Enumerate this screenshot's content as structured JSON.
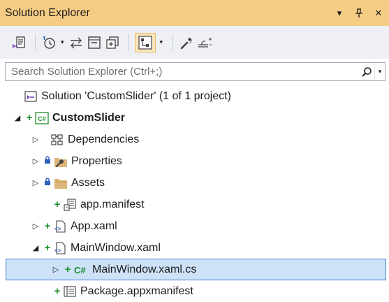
{
  "panel": {
    "title": "Solution Explorer",
    "controls": [
      {
        "name": "dropdown",
        "glyph": "▾"
      },
      {
        "name": "pin",
        "glyph": "⊥"
      },
      {
        "name": "close",
        "glyph": "✕"
      }
    ]
  },
  "toolbar": {
    "icons": [
      "switch-views-icon",
      "pending-changes-filter-icon",
      "sync-with-active-document-icon",
      "collapse-all-icon",
      "show-all-files-icon",
      "preview-selected-items-icon",
      "properties-icon",
      "preview-pane-icon"
    ]
  },
  "search": {
    "placeholder": "Search Solution Explorer (Ctrl+;)"
  },
  "tree": {
    "solution": "Solution 'CustomSlider' (1 of 1 project)",
    "project": "CustomSlider",
    "project_badge": "C#",
    "items": [
      {
        "label": "Dependencies"
      },
      {
        "label": "Properties"
      },
      {
        "label": "Assets"
      },
      {
        "label": "app.manifest"
      },
      {
        "label": "App.xaml"
      },
      {
        "label": "MainWindow.xaml"
      },
      {
        "label": "MainWindow.xaml.cs",
        "badge": "C#"
      },
      {
        "label": "Package.appxmanifest"
      }
    ]
  },
  "colors": {
    "titlebar": "#f5cc84",
    "toolbar": "#eef0f6",
    "selection": "#cde1f7",
    "selection_border": "#3d7fd8",
    "add_glyph": "#1e8f2b",
    "lock_glyph": "#2d5fbd"
  }
}
